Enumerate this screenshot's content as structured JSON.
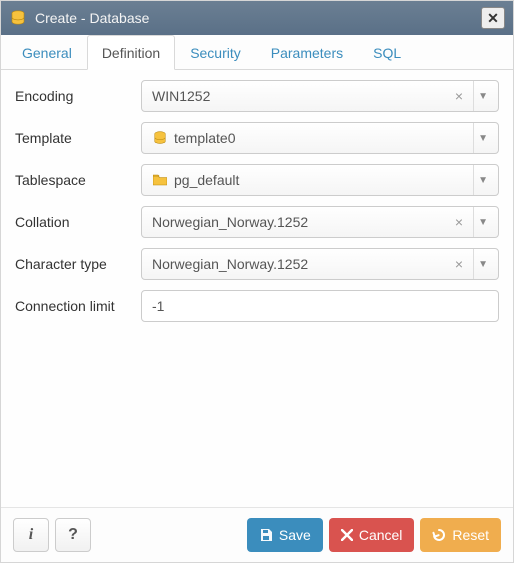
{
  "titlebar": {
    "title": "Create - Database"
  },
  "tabs": [
    {
      "id": "general",
      "label": "General"
    },
    {
      "id": "definition",
      "label": "Definition"
    },
    {
      "id": "security",
      "label": "Security"
    },
    {
      "id": "parameters",
      "label": "Parameters"
    },
    {
      "id": "sql",
      "label": "SQL"
    }
  ],
  "active_tab": "definition",
  "form": {
    "encoding": {
      "label": "Encoding",
      "value": "WIN1252",
      "clearable": true
    },
    "template": {
      "label": "Template",
      "value": "template0",
      "clearable": false
    },
    "tablespace": {
      "label": "Tablespace",
      "value": "pg_default",
      "clearable": false
    },
    "collation": {
      "label": "Collation",
      "value": "Norwegian_Norway.1252",
      "clearable": true
    },
    "character_type": {
      "label": "Character type",
      "value": "Norwegian_Norway.1252",
      "clearable": true
    },
    "conn_limit": {
      "label": "Connection limit",
      "value": "-1"
    }
  },
  "footer": {
    "save": "Save",
    "cancel": "Cancel",
    "reset": "Reset"
  },
  "colors": {
    "header_bg": "#5a7087",
    "link": "#3b8dbd",
    "save": "#3b8dbd",
    "cancel": "#d9534f",
    "reset": "#f0ad4e",
    "db_icon": "#f3b21b",
    "folder_icon": "#f3b21b"
  }
}
